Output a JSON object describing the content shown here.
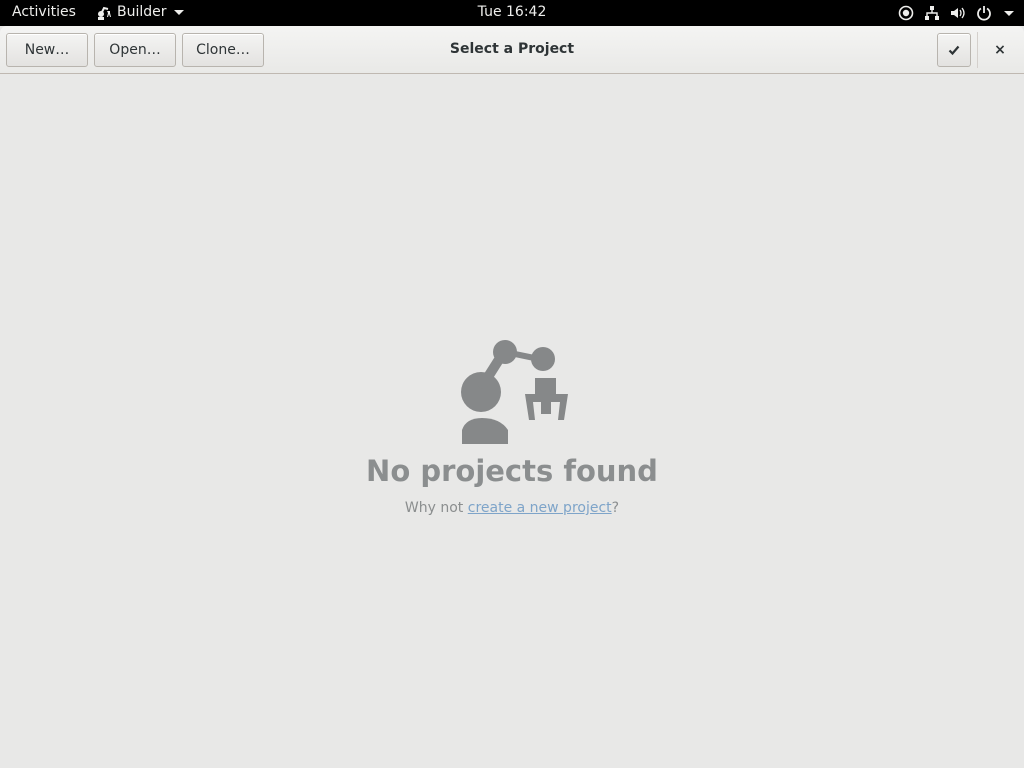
{
  "topbar": {
    "activities": "Activities",
    "app_name": "Builder",
    "clock": "Tue 16:42",
    "tray_icons": [
      "accessibility-icon",
      "network-icon",
      "volume-icon",
      "power-icon"
    ]
  },
  "header": {
    "new_label": "New…",
    "open_label": "Open…",
    "clone_label": "Clone…",
    "title": "Select a Project",
    "check_icon": "check-icon",
    "close_glyph": "×"
  },
  "empty_state": {
    "icon": "robot-arm-icon",
    "title": "No projects found",
    "sub_prefix": "Why not ",
    "sub_link": "create a new project",
    "sub_suffix": "?"
  },
  "colors": {
    "background": "#e8e8e7",
    "empty_text": "#8b8e8f",
    "link": "#7ea4c9"
  }
}
